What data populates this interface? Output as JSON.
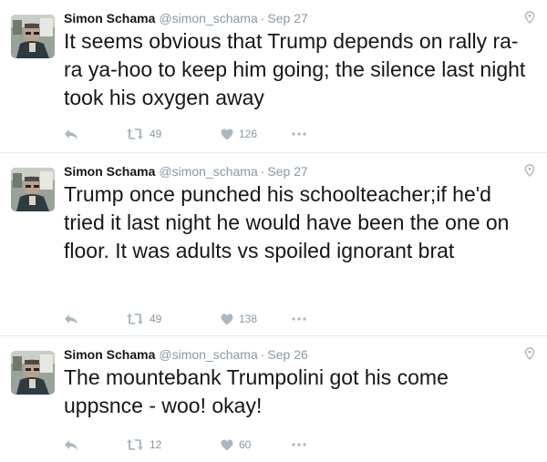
{
  "tweets": [
    {
      "name": "Simon Schama",
      "handle": "@simon_schama",
      "separator": "·",
      "date": "Sep 27",
      "text": "It seems obvious that Trump depends on rally ra-ra ya-hoo to keep him going; the silence last night took his oxygen away",
      "retweets": "49",
      "likes": "126"
    },
    {
      "name": "Simon Schama",
      "handle": "@simon_schama",
      "separator": "·",
      "date": "Sep 27",
      "text": "Trump once punched his schoolteacher;if he'd tried it last night he would have been the one on floor. It was adults vs spoiled ignorant brat",
      "retweets": "49",
      "likes": "138"
    },
    {
      "name": "Simon Schama",
      "handle": "@simon_schama",
      "separator": "·",
      "date": "Sep 26",
      "text": "The mountebank Trumpolini got his come uppsnce - woo! okay!",
      "retweets": "12",
      "likes": "60"
    }
  ],
  "icons": {
    "reply": "reply-icon",
    "retweet": "retweet-icon",
    "like": "heart-icon",
    "more": "more-dots-icon",
    "caret": "location-pin-icon"
  },
  "colors": {
    "text": "#14171a",
    "muted": "#8899a6",
    "divider": "#e6ecf0"
  }
}
